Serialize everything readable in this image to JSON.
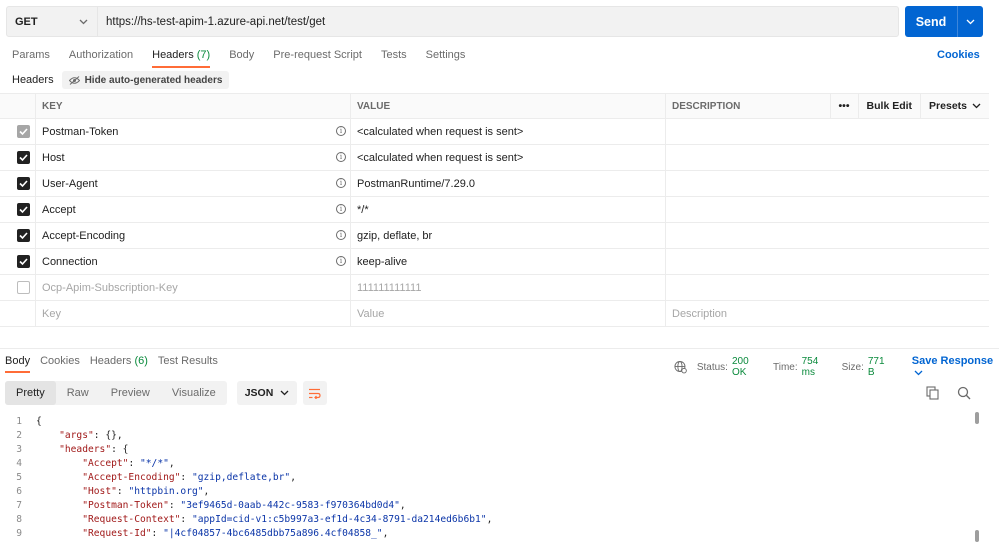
{
  "request": {
    "method": "GET",
    "url": "https://hs-test-apim-1.azure-api.net/test/get",
    "send_label": "Send"
  },
  "req_tabs": [
    {
      "label": "Params"
    },
    {
      "label": "Authorization"
    },
    {
      "label": "Headers",
      "count": "(7)"
    },
    {
      "label": "Body"
    },
    {
      "label": "Pre-request Script"
    },
    {
      "label": "Tests"
    },
    {
      "label": "Settings"
    }
  ],
  "cookies_label": "Cookies",
  "headers_section": {
    "title": "Headers",
    "hide_auto_label": "Hide auto-generated headers"
  },
  "table": {
    "columns": {
      "key": "KEY",
      "value": "VALUE",
      "description": "DESCRIPTION"
    },
    "more_icon": "•••",
    "bulk_edit": "Bulk Edit",
    "presets": "Presets",
    "rows": [
      {
        "key": "Postman-Token",
        "value": "<calculated when request is sent>",
        "state": "grey"
      },
      {
        "key": "Host",
        "value": "<calculated when request is sent>",
        "state": "checked"
      },
      {
        "key": "User-Agent",
        "value": "PostmanRuntime/7.29.0",
        "state": "checked"
      },
      {
        "key": "Accept",
        "value": "*/*",
        "state": "checked"
      },
      {
        "key": "Accept-Encoding",
        "value": "gzip, deflate, br",
        "state": "checked"
      },
      {
        "key": "Connection",
        "value": "keep-alive",
        "state": "checked"
      },
      {
        "key": "Ocp-Apim-Subscription-Key",
        "value": "111111111111",
        "state": "unchecked"
      }
    ],
    "placeholder": {
      "key": "Key",
      "value": "Value",
      "description": "Description"
    }
  },
  "response": {
    "tabs": [
      {
        "label": "Body"
      },
      {
        "label": "Cookies"
      },
      {
        "label": "Headers",
        "count": "(6)"
      },
      {
        "label": "Test Results"
      }
    ],
    "status_label": "Status:",
    "status_value": "200 OK",
    "time_label": "Time:",
    "time_value": "754 ms",
    "size_label": "Size:",
    "size_value": "771 B",
    "save_label": "Save Response",
    "views": [
      "Pretty",
      "Raw",
      "Preview",
      "Visualize"
    ],
    "format": "JSON"
  },
  "code_lines": [
    {
      "n": "1",
      "t": "{"
    },
    {
      "n": "2",
      "t": "    \"args\": {},"
    },
    {
      "n": "3",
      "t": "    \"headers\": {"
    },
    {
      "n": "4",
      "t": "        \"Accept\": \"*/*\","
    },
    {
      "n": "5",
      "t": "        \"Accept-Encoding\": \"gzip,deflate,br\","
    },
    {
      "n": "6",
      "t": "        \"Host\": \"httpbin.org\","
    },
    {
      "n": "7",
      "t": "        \"Postman-Token\": \"3ef9465d-0aab-442c-9583-f970364bd0d4\","
    },
    {
      "n": "8",
      "t": "        \"Request-Context\": \"appId=cid-v1:c5b997a3-ef1d-4c34-8791-da214ed6b6b1\","
    },
    {
      "n": "9",
      "t": "        \"Request-Id\": \"|4cf04857-4bc6485dbb75a896.4cf04858_\","
    }
  ]
}
